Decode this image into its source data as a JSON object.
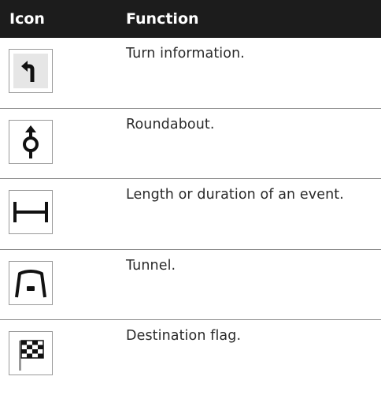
{
  "header": {
    "col_icon": "Icon",
    "col_function": "Function"
  },
  "rows": [
    {
      "icon": "turn-left-arrow-icon",
      "text": "Turn information."
    },
    {
      "icon": "roundabout-icon",
      "text": "Roundabout."
    },
    {
      "icon": "length-bar-icon",
      "text": "Length or duration of an event."
    },
    {
      "icon": "tunnel-icon",
      "text": "Tunnel."
    },
    {
      "icon": "checkered-flag-icon",
      "text": "Destination flag."
    }
  ]
}
